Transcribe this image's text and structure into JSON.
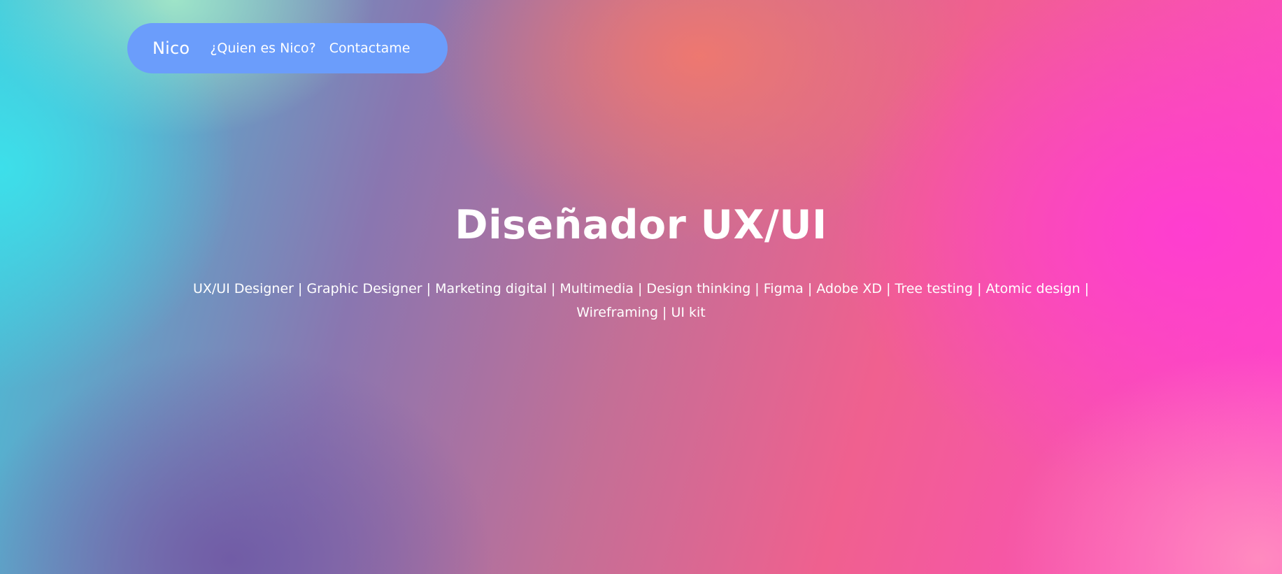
{
  "nav": {
    "brand": "Nico",
    "links": [
      {
        "label": "¿Quien es Nico?"
      },
      {
        "label": "Contactame"
      }
    ]
  },
  "hero": {
    "title": "Diseñador UX/UI",
    "subtitle": "UX/UI Designer | Graphic Designer | Marketing digital | Multimedia | Design thinking | Figma | Adobe XD | Tree testing | Atomic design | Wireframing | UI kit"
  },
  "colors": {
    "nav_background": "#6b9dfb",
    "text": "#ffffff",
    "gradient_teal": "#43c6da",
    "gradient_purple": "#705aa5",
    "gradient_coral": "#f0786e",
    "gradient_pink": "#ff3cd2"
  }
}
